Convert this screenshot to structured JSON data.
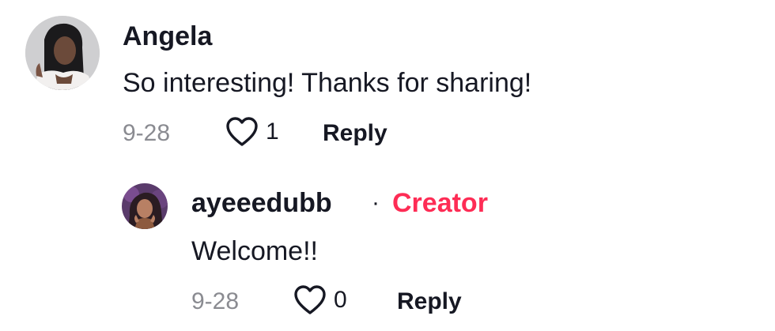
{
  "comment": {
    "username": "Angela",
    "text": "So interesting! Thanks for sharing!",
    "date": "9-28",
    "likes": "1",
    "reply_label": "Reply",
    "avatar_icon": "profile-photo"
  },
  "reply": {
    "username": "ayeeedubb",
    "separator": "·",
    "badge": "Creator",
    "text": "Welcome!!",
    "date": "9-28",
    "likes": "0",
    "reply_label": "Reply",
    "avatar_icon": "profile-photo"
  },
  "colors": {
    "text": "#161823",
    "muted": "#8a8b91",
    "creator": "#FE2C55"
  }
}
